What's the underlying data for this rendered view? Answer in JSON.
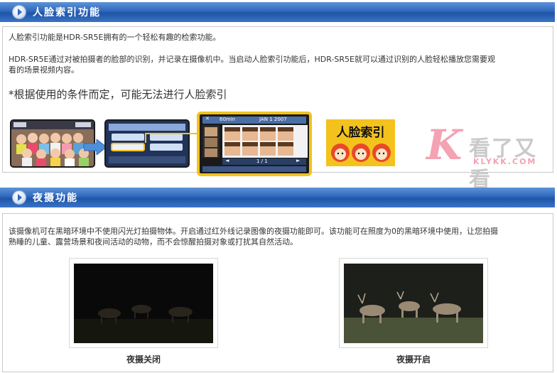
{
  "section1": {
    "title": "人脸索引功能",
    "line1": "人脸索引功能是HDR-SR5E拥有的一个轻松有趣的检索功能。",
    "line2a": "HDR-SR5E通过对被拍摄者的脸部的识别，并记录在摄像机中。当启动人脸索引功能后，HDR-SR5E就可以通过识别的人脸轻松播放您需要观",
    "line2b": "看的场景视频内容。",
    "note": "*根据使用的条件而定，可能无法进行人脸索引",
    "screen": {
      "top_left": "60min",
      "top_mid": "JAN 1 2007",
      "page": "1 / 1"
    },
    "logo_text": "人脸索引"
  },
  "section2": {
    "title": "夜摄功能",
    "line1": "该摄像机可在黑暗环境中不使用闪光灯拍摄物体。开启通过红外线记录图像的夜摄功能即可。该功能可在照度为0的黑暗环境中使用，让您拍摄",
    "line2": "熟睡的儿童、露营场景和夜间活动的动物，而不会惊醒拍摄对象或打扰其自然活动。",
    "caption_off": "夜摄关闭",
    "caption_on": "夜摄开启"
  },
  "watermark": {
    "cn": "看了又看",
    "en": "KLYKK.COM"
  },
  "colors": {
    "bar": "#2f68bd",
    "highlight": "#f3c21a",
    "logo_bg": "#f4c21c",
    "watermark_pink": "#f3a3b3"
  }
}
